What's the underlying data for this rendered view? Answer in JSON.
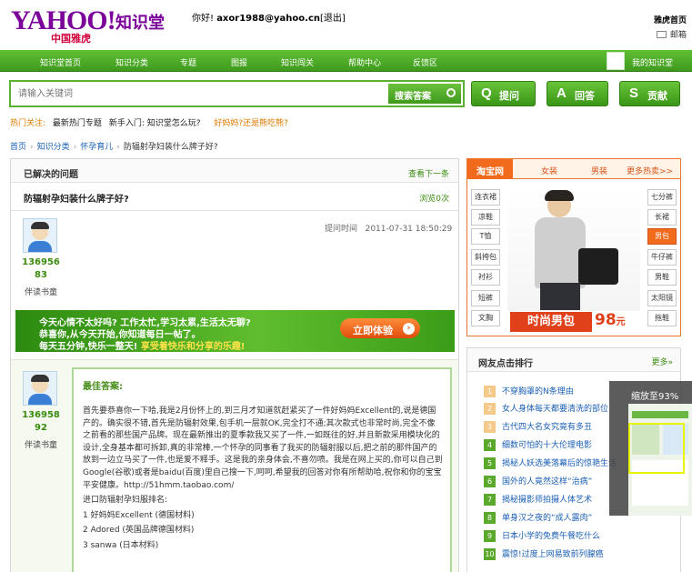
{
  "header": {
    "logo": "YAHOO!",
    "logo_sub": "中国雅虎",
    "logo_zh": "知识堂",
    "greeting_prefix": "你好! ",
    "user_email": "axor1988@yahoo.cn",
    "logout": "[退出]",
    "yahoo_home": "雅虎首页",
    "mail": "邮箱"
  },
  "nav": {
    "items": [
      "知识堂首页",
      "知识分类",
      "专题",
      "图报",
      "知识闯关",
      "帮助中心",
      "反馈区"
    ],
    "my_zhishitang": "我的知识堂"
  },
  "search": {
    "placeholder": "请输入关键词",
    "button": "搜索答案"
  },
  "actions": {
    "ask": {
      "glyph": "Q",
      "label": "提问"
    },
    "answer": {
      "glyph": "A",
      "label": "回答"
    },
    "contribute": {
      "glyph": "S",
      "label": "贡献"
    }
  },
  "hot": {
    "label": "热门关注:",
    "links": [
      "最新热门专题",
      "新手入门: 知识堂怎么玩?"
    ],
    "orange_link": "好妈妈?还是熊吃熊?"
  },
  "breadcrumb": [
    "首页",
    "知识分类",
    "怀孕育儿",
    "防辐射孕妇装什么牌子好?"
  ],
  "question": {
    "section_title": "已解决的问题",
    "next_link": "查看下一条",
    "title": "防辐射孕妇装什么牌子好?",
    "views": "浏览0次",
    "time_label": "提问时间",
    "time": "2011-07-31 18:50:29",
    "asker": {
      "id_line1": "136956",
      "id_line2": "83",
      "title": "伴读书童"
    }
  },
  "banner": {
    "line1": "今天心情不太好吗? 工作太忙,学习太累,生活太无聊?",
    "line2": "恭喜你,从今天开始,你知道每日一帖了。",
    "line3_white": "每天五分钟,快乐一整天!",
    "line3_yellow": "享受着快乐和分享的乐趣!",
    "button": "立即体验"
  },
  "answer": {
    "answerer": {
      "id_line1": "136958",
      "id_line2": "92",
      "title": "伴读书童"
    },
    "best_label": "最佳答案:",
    "paragraph": "首先要恭喜你一下哈,我是2月份怀上的,到三月才知道就赶紧买了一件好妈妈Excellent的,说是德国产的。确实很不错,首先是防辐射效果,包手机一层就OK,完全打不通;其次款式也非常时尚,完全不像之前看的那些国产品牌。现在最新推出的夏季款我又买了一件,一如既往的好,并且新款采用模块化的设计,全身基本都可拆卸,真的非常棒,一个怀孕的同事看了我买的防辐射服以后,把之前的那件国产的放到一边立马买了一件,也是爱不释手。这是我的亲身体会,不喜勿喷。我是在网上买的,你可以自己到Google(谷歌)或者是baidu(百度)里自己搜一下,呵呵,希望我的回答对你有所帮助哈,祝你和你的宝宝平安健康。http://51hmm.taobao.com/",
    "brands_intro": "进口防辐射孕妇服排名:",
    "brands": [
      "1 好妈妈Excellent (德国材料)",
      "2 Adored (英国品牌德国材料)",
      "3 sanwa (日本材料)"
    ]
  },
  "side_ad": {
    "tabs": [
      "淘宝网",
      "女装",
      "男装",
      "更多热卖>>"
    ],
    "left_categories": [
      "连衣裙",
      "凉鞋",
      "T恤",
      "斜挎包",
      "衬衫",
      "短裤",
      "文胸"
    ],
    "right_categories": [
      "七分裤",
      "长裙",
      "男包",
      "牛仔裤",
      "男鞋",
      "太阳镜",
      "拖鞋"
    ],
    "active_category": "男包",
    "promo_label": "时尚男包",
    "price": "98",
    "price_unit": "元"
  },
  "ranking": {
    "title": "网友点击排行",
    "more": "更多»",
    "items": [
      "不穿胸罩的N条理由",
      "女人身体每天都要清洗的部位",
      "古代四大名女究竟有多丑",
      "细数可怕的十大伦理电影",
      "揭秘人妖选美落幕后的惊艳生活",
      "国外的人竟然这样“治病”",
      "揭秘摄影师拍摄人体艺术",
      "单身汉之夜的“成人露肉”",
      "日本小学的免费午餐吃什么",
      "震惊!过度上网易致前列腺癌"
    ]
  },
  "zoom": {
    "text": "缩放至93%"
  },
  "colors": {
    "brand_purple": "#7b0099",
    "nav_green": "#4fac26",
    "accent_orange": "#f26b1d",
    "link_blue": "#1a5fb4"
  }
}
